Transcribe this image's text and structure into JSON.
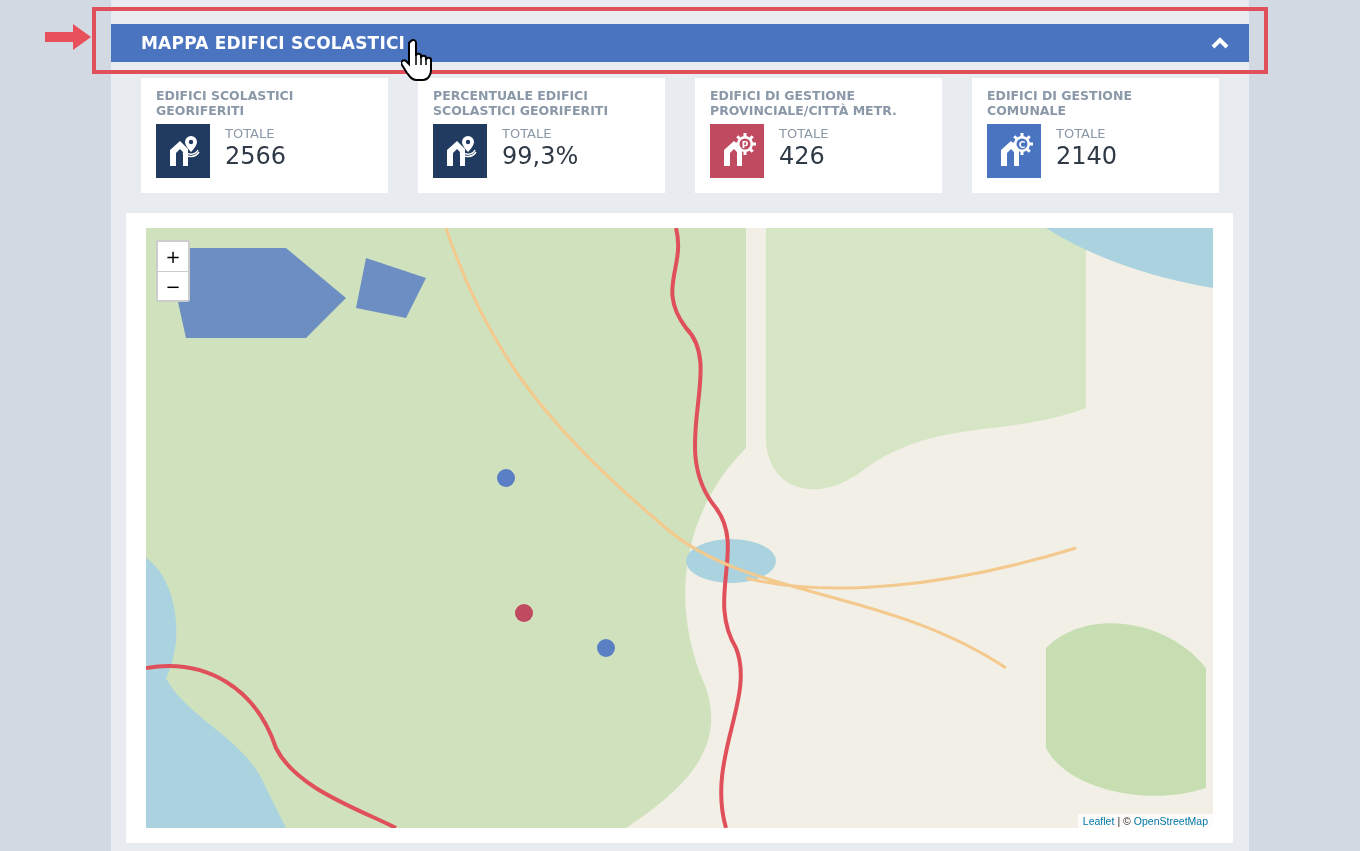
{
  "header": {
    "title": "MAPPA EDIFICI SCOLASTICI",
    "expanded": true
  },
  "cards": [
    {
      "title": "EDIFICI SCOLASTICI GEORIFERITI",
      "label": "TOTALE",
      "value": "2566",
      "kind": "pin",
      "color": "#213a5f"
    },
    {
      "title": "PERCENTUALE EDIFICI SCOLASTICI GEORIFERITI",
      "label": "TOTALE",
      "value": "99,3%",
      "kind": "pin",
      "color": "#213a5f"
    },
    {
      "title": "EDIFICI DI GESTIONE PROVINCIALE/CITTÀ METR.",
      "label": "TOTALE",
      "value": "426",
      "kind": "gear",
      "color": "#c04a5f",
      "icon_letter": "P"
    },
    {
      "title": "EDIFICI DI GESTIONE COMUNALE",
      "label": "TOTALE",
      "value": "2140",
      "kind": "gear",
      "color": "#4a74bf",
      "icon_letter": "C"
    }
  ],
  "map": {
    "kind": "picture",
    "zoom_controls": [
      "+",
      "−"
    ],
    "attribution": [
      {
        "kind": "link",
        "text": "Leaflet"
      },
      {
        "kind": "sep",
        "text": "|"
      },
      {
        "kind": "text",
        "text": "©"
      },
      {
        "kind": "link",
        "text": "OpenStreetMap"
      }
    ]
  }
}
